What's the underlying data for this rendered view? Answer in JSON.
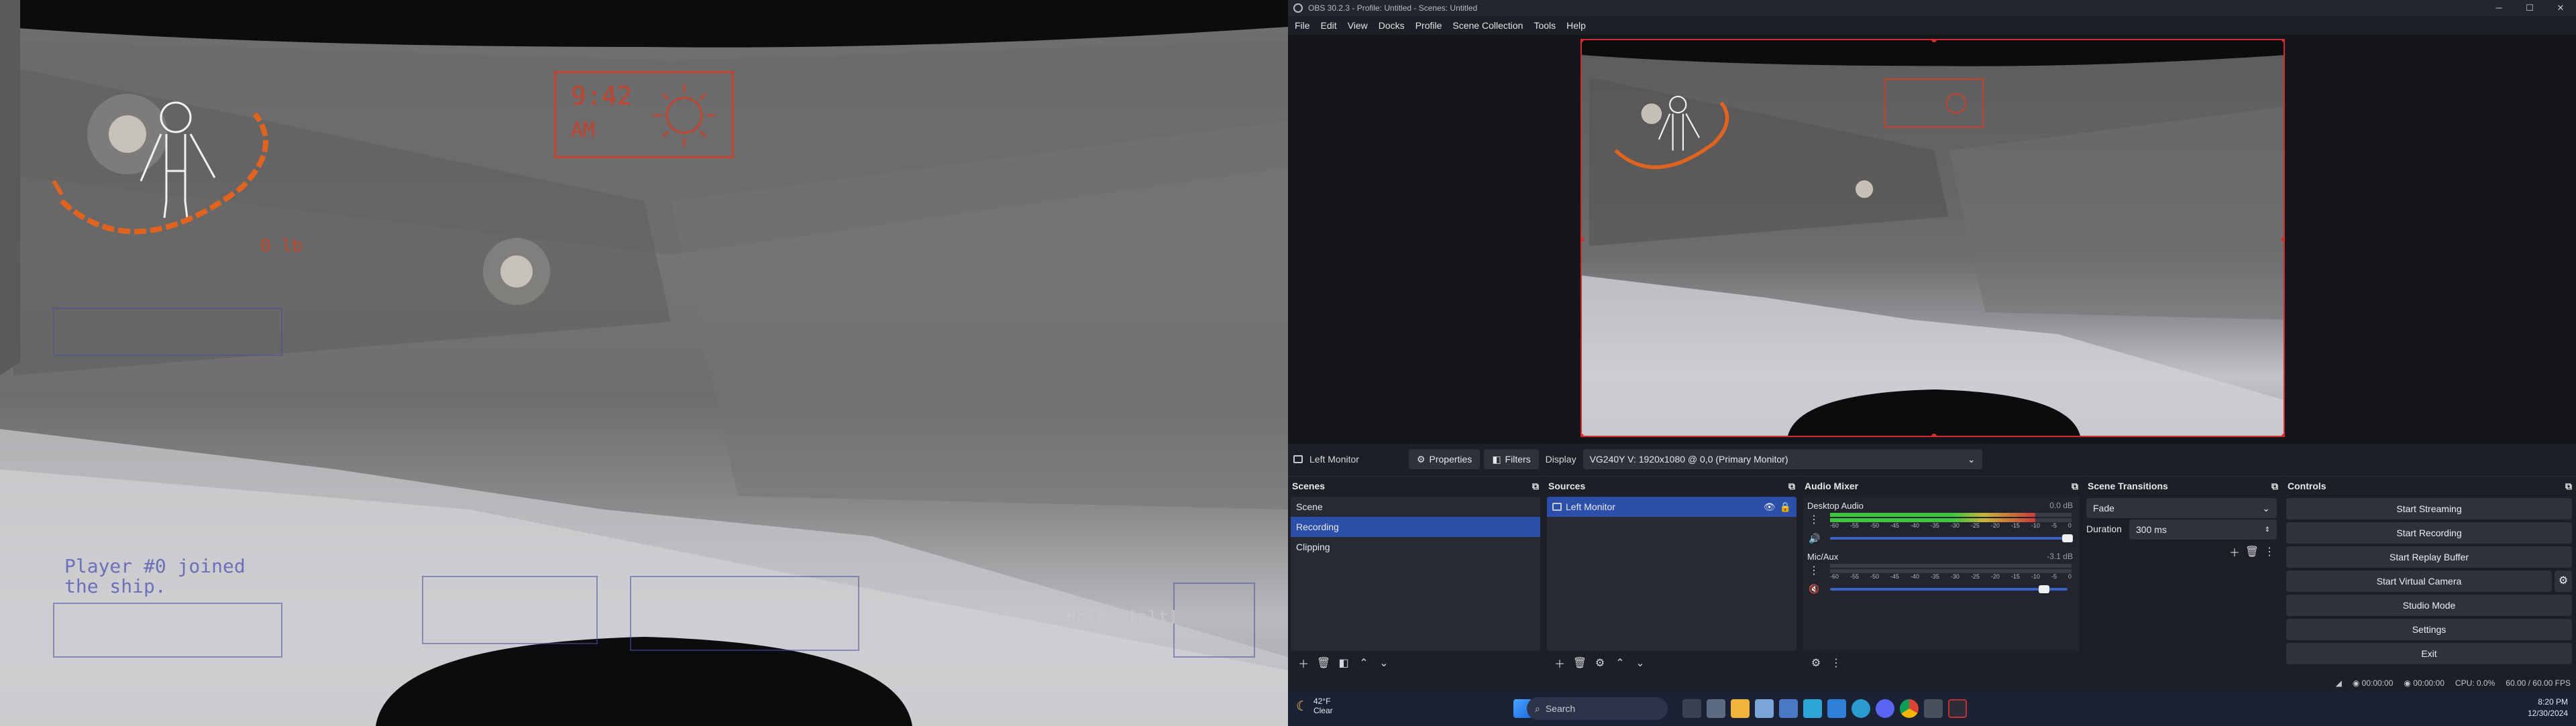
{
  "game": {
    "clock_time": "9:42",
    "clock_ampm": "AM",
    "weight": "0 lb",
    "chat_line1": "Player #0 joined",
    "chat_line2": "the ship.",
    "hold_hint": "Hold: [alt]"
  },
  "obs": {
    "title": "OBS 30.2.3 - Profile: Untitled - Scenes: Untitled",
    "menu": [
      "File",
      "Edit",
      "View",
      "Docks",
      "Profile",
      "Scene Collection",
      "Tools",
      "Help"
    ],
    "source_bar": {
      "source_name": "Left Monitor",
      "properties_label": "Properties",
      "filters_label": "Filters",
      "display_label": "Display",
      "display_value": "VG240Y V: 1920x1080 @ 0,0 (Primary Monitor)"
    },
    "scenes": {
      "title": "Scenes",
      "items": [
        "Scene",
        "Recording",
        "Clipping"
      ],
      "selected": "Recording"
    },
    "sources": {
      "title": "Sources",
      "items": [
        "Left Monitor"
      ]
    },
    "mixer": {
      "title": "Audio Mixer",
      "scale": [
        "-60",
        "-55",
        "-50",
        "-45",
        "-40",
        "-35",
        "-30",
        "-25",
        "-20",
        "-15",
        "-10",
        "-5",
        "0"
      ],
      "channels": [
        {
          "name": "Desktop Audio",
          "db": "0.0 dB",
          "level": 0.85,
          "volume": 1.0
        },
        {
          "name": "Mic/Aux",
          "db": "-3.1 dB",
          "level": 0.0,
          "volume": 0.9
        }
      ]
    },
    "transitions": {
      "title": "Scene Transitions",
      "selected": "Fade",
      "duration_label": "Duration",
      "duration_value": "300 ms"
    },
    "controls": {
      "title": "Controls",
      "buttons": [
        "Start Streaming",
        "Start Recording",
        "Start Replay Buffer",
        "Start Virtual Camera",
        "Studio Mode",
        "Settings",
        "Exit"
      ]
    },
    "status": {
      "rec_time": "00:00:00",
      "stream_time": "00:00:00",
      "cpu": "CPU: 0.0%",
      "fps": "60.00 / 60.00 FPS"
    }
  },
  "taskbar": {
    "weather_temp": "42°F",
    "weather_desc": "Clear",
    "search_placeholder": "Search",
    "time": "8:20 PM",
    "date": "12/30/2024"
  },
  "colors": {
    "hud_red": "#c0442f",
    "hud_orange": "#e0641f",
    "selection": "#2c4fa9",
    "meter_green": "#3fc43f",
    "meter_yellow": "#c8b53a",
    "meter_red": "#c83a3a"
  }
}
